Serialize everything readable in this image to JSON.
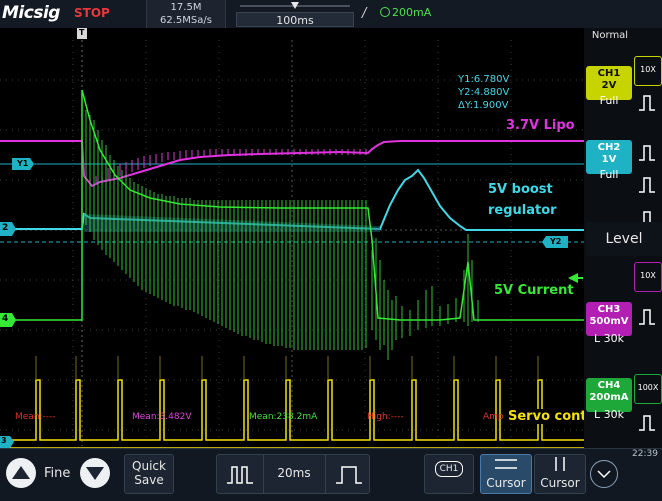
{
  "header": {
    "logo": "Micsig",
    "status": "STOP",
    "memory_depth": "17.5M",
    "sample_rate": "62.5MSa/s",
    "timebase": "100ms",
    "trigger_symbol": "/",
    "trigger_level": "200mA"
  },
  "trigger_mode": "Normal",
  "cursor_readout": {
    "y1": "Y1:6.780V",
    "y2": "Y2:4.880V",
    "delta": "ΔY:1.900V"
  },
  "waveform_labels": {
    "lipo": "3.7V Lipo",
    "boost_line1": "5V boost",
    "boost_line2": "regulator",
    "current": "5V Current",
    "servo": "Servo control"
  },
  "markers": {
    "trigger": "T",
    "y1": "Y1",
    "y2": "Y2",
    "ch2_ref": "2",
    "ch3_ref": "3",
    "ch4_ref": "4"
  },
  "measurements": [
    {
      "label": "Mean:----",
      "color": "#e0302a"
    },
    {
      "label": "Mean:3.482V",
      "color": "#e040e0"
    },
    {
      "label": "Mean:238.2mA",
      "color": "#40e040"
    },
    {
      "label": "High:----",
      "color": "#e0302a"
    },
    {
      "label": "Amp",
      "color": "#e0302a"
    }
  ],
  "channels": [
    {
      "name": "CH1",
      "scale": "2V",
      "coupling": "Full",
      "color": "#c8d400",
      "probe": "10X"
    },
    {
      "name": "CH2",
      "scale": "1V",
      "coupling": "Full",
      "color": "#1fb2c4",
      "probe": "10X"
    },
    {
      "name": "CH3",
      "scale": "500mV",
      "coupling": "L 30k",
      "color": "#b21fb2",
      "probe": "10X"
    },
    {
      "name": "CH4",
      "scale": "200mA",
      "coupling": "L 30k",
      "color": "#1fa83a",
      "probe": "100X"
    }
  ],
  "level_label": "Level",
  "bottom": {
    "fine_label": "Fine",
    "quick_save_line1": "Quick",
    "quick_save_line2": "Save",
    "timebase": "20ms",
    "ch_badge": "CH1",
    "cursor1": "Cursor",
    "cursor2": "Cursor",
    "clock": "22:39"
  },
  "colors": {
    "ch1_yellow": "#f5e10a",
    "ch2_cyan": "#3fd8e8",
    "ch3_magenta": "#e033e0",
    "ch4_green": "#35e835"
  }
}
